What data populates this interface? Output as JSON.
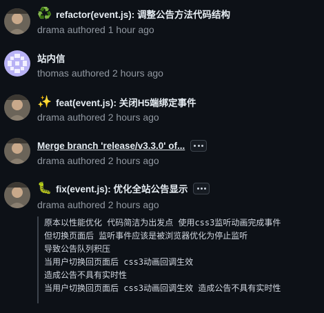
{
  "commits": [
    {
      "emoji": "♻️",
      "title": "refactor(event.js): 调整公告方法代码结构",
      "author": "drama",
      "action": "authored",
      "time": "1 hour ago"
    },
    {
      "emoji": "",
      "title": "站内信",
      "author": "thomas",
      "action": "authored",
      "time": "2 hours ago"
    },
    {
      "emoji": "✨",
      "title": "feat(event.js): 关闭H5端绑定事件",
      "author": "drama",
      "action": "authored",
      "time": "2 hours ago"
    },
    {
      "emoji": "",
      "title": "Merge branch 'release/v3.3.0' of...",
      "author": "drama",
      "action": "authored",
      "time": "2 hours ago"
    },
    {
      "emoji": "🐛",
      "title": "fix(event.js): 优化全站公告显示",
      "author": "drama",
      "action": "authored",
      "time": "2 hours ago"
    }
  ],
  "commit_body": [
    "原本以性能优化 代码简洁为出发点 使用css3监听动画完成事件",
    "但切换页面后 监听事件应该是被浏览器优化为停止监听",
    "导致公告队列积压",
    "当用户切换回页面后 css3动画回调生效",
    "造成公告不具有实时性",
    "当用户切换回页面后 css3动画回调生效 造成公告不具有实时性"
  ],
  "colors": {
    "background": "#0d1117",
    "text": "#e6edf3",
    "muted": "#9198a1",
    "thomas_avatar": "#b8b2f5"
  }
}
